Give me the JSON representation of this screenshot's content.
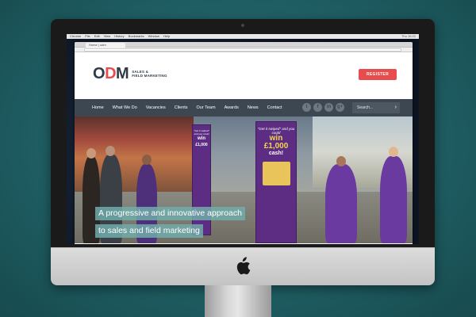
{
  "menubar": {
    "items": [
      "Chrome",
      "File",
      "Edit",
      "View",
      "History",
      "Bookmarks",
      "Window",
      "Help"
    ],
    "right": "Thu 16:22"
  },
  "browser": {
    "tab_title": "Home | odm"
  },
  "site": {
    "logo": {
      "letters": [
        "O",
        "D",
        "M"
      ],
      "subtitle_line1": "SALES &",
      "subtitle_line2": "FIELD MARKETING"
    },
    "register_label": "REGISTER",
    "nav": [
      {
        "label": "Home"
      },
      {
        "label": "What We Do"
      },
      {
        "label": "Vacancies"
      },
      {
        "label": "Clients"
      },
      {
        "label": "Our Team"
      },
      {
        "label": "Awards"
      },
      {
        "label": "News"
      },
      {
        "label": "Contact"
      }
    ],
    "social": [
      {
        "icon": "twitter-icon",
        "glyph": "t"
      },
      {
        "icon": "facebook-icon",
        "glyph": "f"
      },
      {
        "icon": "linkedin-icon",
        "glyph": "in"
      },
      {
        "icon": "googleplus-icon",
        "glyph": "g+"
      }
    ],
    "search_placeholder": "Search...",
    "search_glyph": "›",
    "hero": {
      "tagline_line1": "A progressive and innovative approach",
      "tagline_line2": "to sales and field marketing",
      "banner_small": "\"Get it swiped\" and you could",
      "banner_win": "win",
      "banner_amount": "£1,000",
      "banner_cash": "cash!"
    }
  },
  "colors": {
    "accent": "#e84c4c",
    "nav_bg": "#3c4752",
    "brand_dark": "#2f3c47",
    "tagline_bg": "#71acaa",
    "banner_purple": "#5c2d82"
  }
}
